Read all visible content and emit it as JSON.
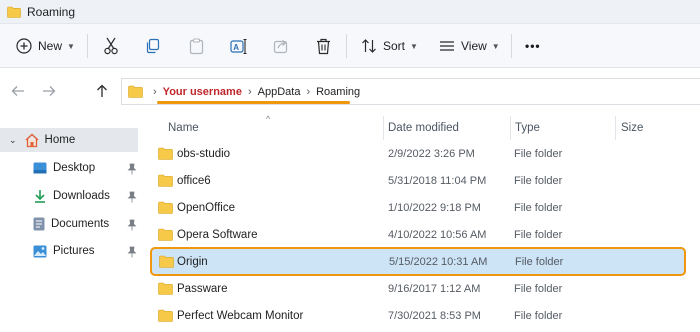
{
  "window": {
    "title": "Roaming",
    "icon": "folder-icon"
  },
  "ribbon": {
    "new_label": "New",
    "sort_label": "Sort",
    "view_label": "View",
    "more_label": "•••",
    "tools": [
      "cut-icon",
      "copy-icon",
      "paste-icon",
      "rename-icon",
      "share-icon",
      "delete-icon"
    ]
  },
  "address": {
    "crumbs": [
      "Your username",
      "AppData",
      "Roaming"
    ],
    "highlight_color": "#f0960f",
    "username_color": "#c0272d"
  },
  "sidebar": {
    "home_label": "Home",
    "items": [
      {
        "label": "Desktop",
        "icon": "desktop-icon"
      },
      {
        "label": "Downloads",
        "icon": "download-icon"
      },
      {
        "label": "Documents",
        "icon": "document-icon"
      },
      {
        "label": "Pictures",
        "icon": "pictures-icon"
      }
    ]
  },
  "columns": {
    "name": "Name",
    "date": "Date modified",
    "type": "Type",
    "size": "Size"
  },
  "files": [
    {
      "name": "obs-studio",
      "date": "2/9/2022 3:26 PM",
      "type": "File folder"
    },
    {
      "name": "office6",
      "date": "5/31/2018 11:04 PM",
      "type": "File folder"
    },
    {
      "name": "OpenOffice",
      "date": "1/10/2022 9:18 PM",
      "type": "File folder"
    },
    {
      "name": "Opera Software",
      "date": "4/10/2022 10:56 AM",
      "type": "File folder"
    },
    {
      "name": "Origin",
      "date": "5/15/2022 10:31 AM",
      "type": "File folder",
      "selected": true
    },
    {
      "name": "Passware",
      "date": "9/16/2017 1:12 AM",
      "type": "File folder"
    },
    {
      "name": "Perfect Webcam Monitor",
      "date": "7/30/2021 8:53 PM",
      "type": "File folder"
    }
  ],
  "colors": {
    "selection_bg": "#cde4f7",
    "accent_outline": "#f0960f",
    "folder": "#f7c948"
  }
}
